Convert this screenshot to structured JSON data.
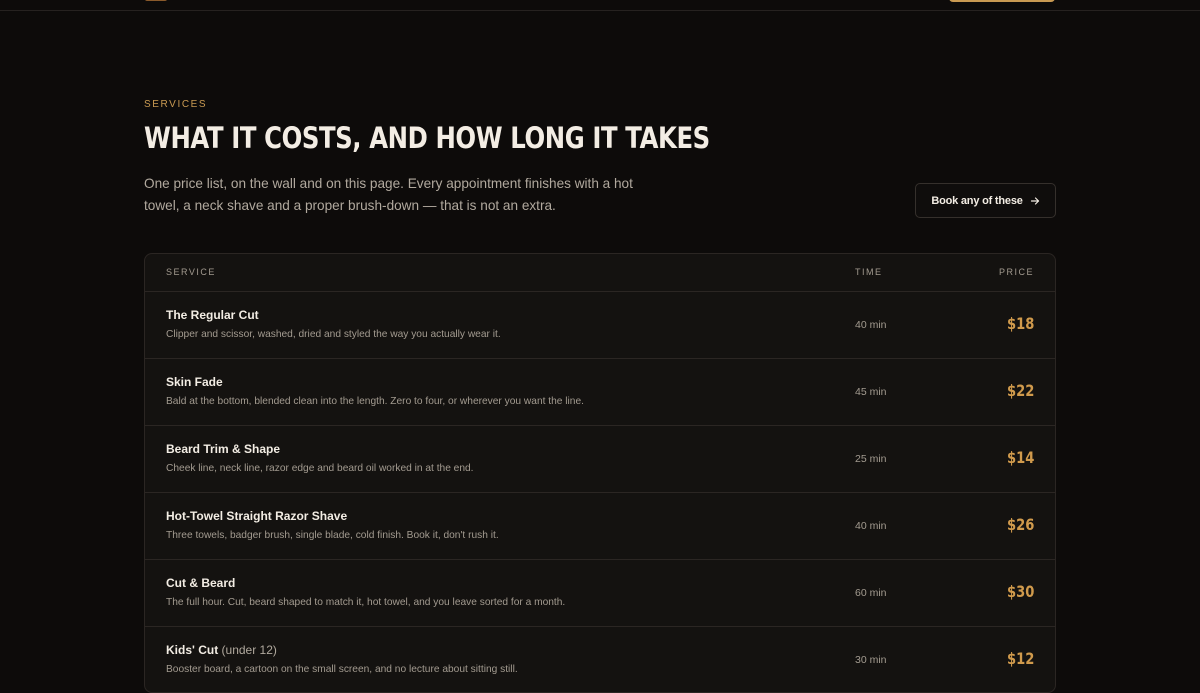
{
  "colors": {
    "background": "#0d0b0a",
    "accent": "#c99a52",
    "price": "#d09a4c",
    "text": "#f3ede4",
    "muted": "#a39b90"
  },
  "header": {
    "logo_icon": "logo-icon",
    "cta_label": ""
  },
  "services": {
    "eyebrow": "SERVICES",
    "title": "WHAT IT COSTS, AND HOW LONG IT TAKES",
    "intro": "One price list, on the wall and on this page. Every appointment finishes with a hot towel, a neck shave and a proper brush-down — that is not an extra.",
    "book_button": "Book any of these",
    "book_icon": "arrow-right-icon",
    "table": {
      "headers": {
        "service": "SERVICE",
        "time": "TIME",
        "price": "PRICE"
      },
      "rows": [
        {
          "name": "The Regular Cut",
          "note": "",
          "description": "Clipper and scissor, washed, dried and styled the way you actually wear it.",
          "time": "40 min",
          "price": "$18"
        },
        {
          "name": "Skin Fade",
          "note": "",
          "description": "Bald at the bottom, blended clean into the length. Zero to four, or wherever you want the line.",
          "time": "45 min",
          "price": "$22"
        },
        {
          "name": "Beard Trim & Shape",
          "note": "",
          "description": "Cheek line, neck line, razor edge and beard oil worked in at the end.",
          "time": "25 min",
          "price": "$14"
        },
        {
          "name": "Hot-Towel Straight Razor Shave",
          "note": "",
          "description": "Three towels, badger brush, single blade, cold finish. Book it, don't rush it.",
          "time": "40 min",
          "price": "$26"
        },
        {
          "name": "Cut & Beard",
          "note": "",
          "description": "The full hour. Cut, beard shaped to match it, hot towel, and you leave sorted for a month.",
          "time": "60 min",
          "price": "$30"
        },
        {
          "name": "Kids' Cut",
          "note": "(under 12)",
          "description": "Booster board, a cartoon on the small screen, and no lecture about sitting still.",
          "time": "30 min",
          "price": "$12"
        }
      ]
    }
  }
}
